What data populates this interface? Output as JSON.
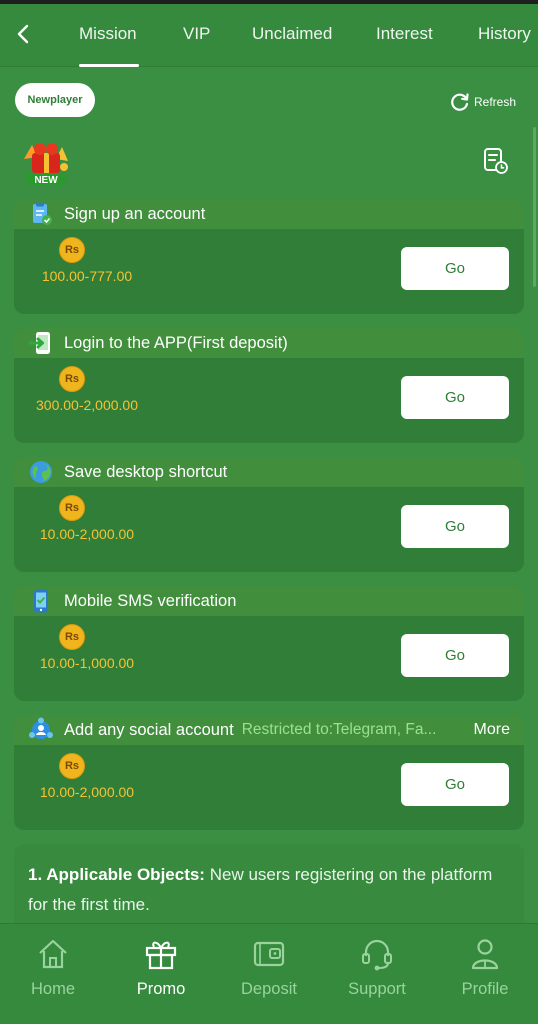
{
  "tabs": [
    {
      "label": "Mission"
    },
    {
      "label": "VIP"
    },
    {
      "label": "Unclaimed"
    },
    {
      "label": "Interest"
    },
    {
      "label": "History"
    }
  ],
  "active_tab": "Mission",
  "filter_chip": "Newplayer",
  "refresh_label": "Refresh",
  "new_badge": "NEW",
  "currency": "Rs",
  "tasks": [
    {
      "title": "Sign up an account",
      "reward": "100.00-777.00",
      "button": "Go",
      "icon": "clipboard-check-icon"
    },
    {
      "title": "Login to the APP(First deposit)",
      "reward": "300.00-2,000.00",
      "button": "Go",
      "icon": "phone-login-icon"
    },
    {
      "title": "Save desktop shortcut",
      "reward": "10.00-2,000.00",
      "button": "Go",
      "icon": "globe-icon"
    },
    {
      "title": "Mobile SMS verification",
      "reward": "10.00-1,000.00",
      "button": "Go",
      "icon": "mobile-icon"
    },
    {
      "title": "Add any social account",
      "restriction": "Restricted to:Telegram, Fa...",
      "more": "More",
      "reward": "10.00-2,000.00",
      "button": "Go",
      "icon": "social-icon"
    }
  ],
  "rules": {
    "heading": "1. Applicable Objects:",
    "text": " New users registering on the platform for the first time."
  },
  "bottom_nav": [
    {
      "label": "Home",
      "icon": "home-icon"
    },
    {
      "label": "Promo",
      "icon": "gift-icon"
    },
    {
      "label": "Deposit",
      "icon": "wallet-icon"
    },
    {
      "label": "Support",
      "icon": "headset-icon"
    },
    {
      "label": "Profile",
      "icon": "user-icon"
    }
  ],
  "colors": {
    "background": "#3a8f43",
    "card": "#307e38",
    "reward_text": "#f7c235",
    "coin": "#f0b41c",
    "restriction_text": "#9be08f"
  }
}
